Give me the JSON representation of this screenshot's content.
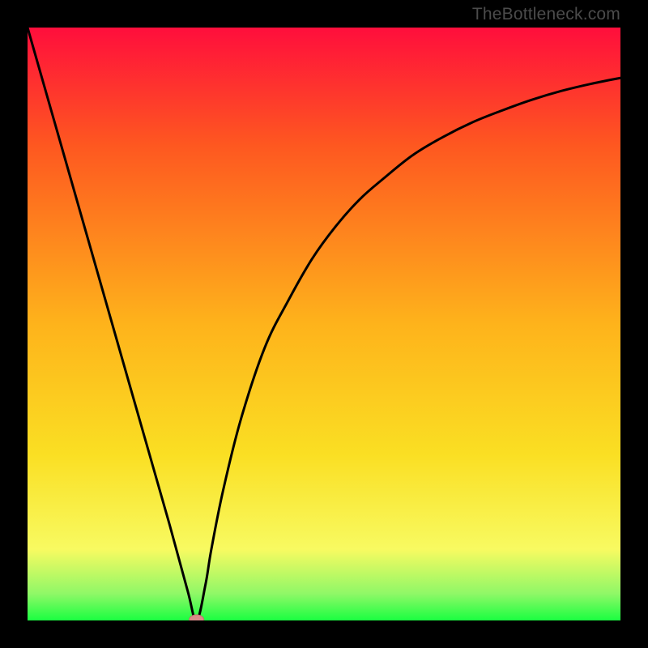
{
  "watermark": "TheBottleneck.com",
  "colors": {
    "frame": "#000000",
    "gradient_top": "#ff0e3c",
    "gradient_mid1": "#fe5820",
    "gradient_mid2": "#feb31b",
    "gradient_mid3": "#fadf23",
    "gradient_mid4": "#f8fa61",
    "gradient_bottom_band": "#8ff867",
    "gradient_bottom": "#1afe41",
    "curve": "#000000",
    "marker_fill": "#d98b89",
    "marker_stroke": "#c36f6c"
  },
  "chart_data": {
    "type": "line",
    "title": "",
    "xlabel": "",
    "ylabel": "",
    "xlim": [
      0,
      100
    ],
    "ylim": [
      0,
      100
    ],
    "series": [
      {
        "name": "bottleneck-curve",
        "x": [
          0,
          4,
          8,
          12,
          16,
          20,
          24,
          27,
          28.5,
          30,
          31,
          33,
          36,
          40,
          44,
          48,
          52,
          56,
          60,
          65,
          70,
          75,
          80,
          85,
          90,
          95,
          100
        ],
        "y": [
          100,
          86,
          72,
          58,
          44,
          30,
          16,
          5,
          0,
          6,
          12,
          22,
          34,
          46,
          54,
          61,
          66.5,
          71,
          74.5,
          78.5,
          81.5,
          84,
          86,
          87.8,
          89.3,
          90.5,
          91.5
        ]
      }
    ],
    "annotations": [
      {
        "type": "marker",
        "x": 28.5,
        "y": 0,
        "label": "optimal-point"
      }
    ]
  }
}
